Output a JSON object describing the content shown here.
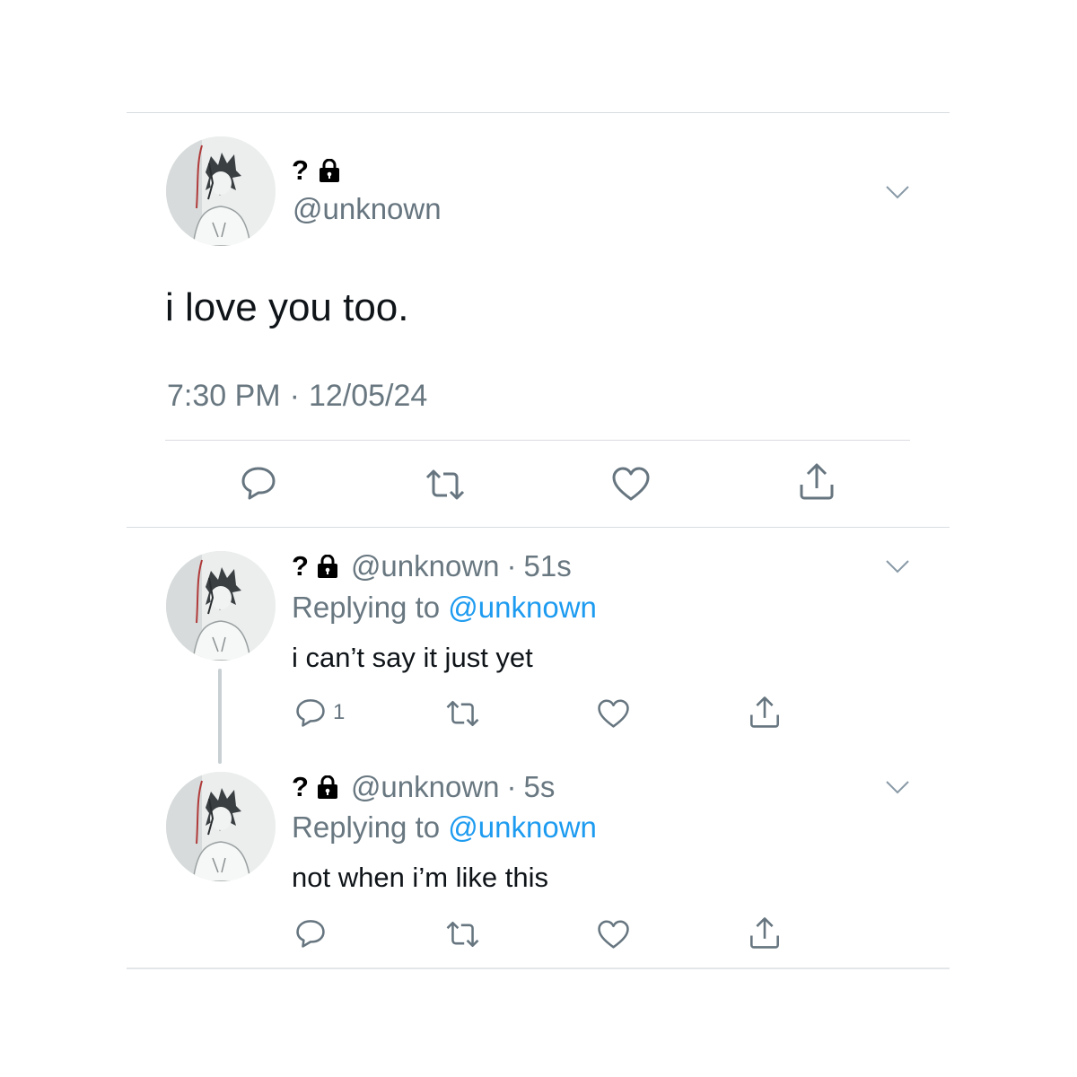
{
  "main_tweet": {
    "display_name": "?",
    "handle": "@unknown",
    "text": "i love you too.",
    "time": "7:30 PM",
    "date": "12/05/24",
    "separator": "·"
  },
  "replies": [
    {
      "display_name": "?",
      "handle": "@unknown",
      "separator": "·",
      "age": "51s",
      "replying_prefix": "Replying to",
      "replying_to": "@unknown",
      "text": "i can’t say it just yet",
      "reply_count": "1"
    },
    {
      "display_name": "?",
      "handle": "@unknown",
      "separator": "·",
      "age": "5s",
      "replying_prefix": "Replying to",
      "replying_to": "@unknown",
      "text": "not when i’m like this",
      "reply_count": ""
    }
  ],
  "icons": {
    "lock": "lock-icon",
    "chevron": "chevron-down-icon",
    "reply": "reply-icon",
    "retweet": "retweet-icon",
    "like": "heart-icon",
    "share": "share-icon"
  },
  "colors": {
    "link": "#1d9bf0",
    "muted": "#687780",
    "icon": "#66757f",
    "divider": "#d9dde0"
  }
}
